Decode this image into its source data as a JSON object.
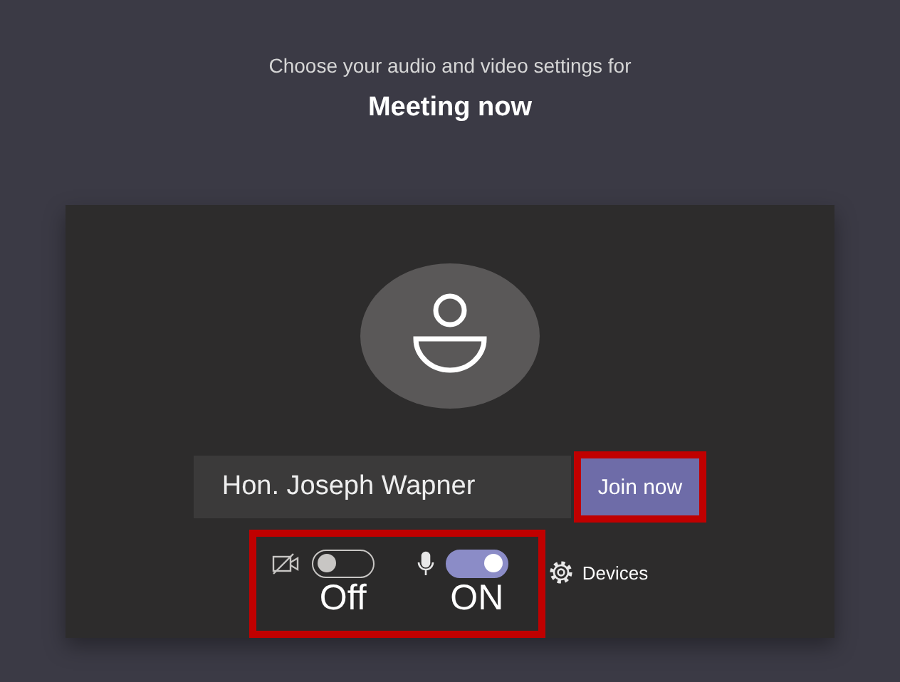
{
  "header": {
    "subtitle": "Choose your audio and video settings for",
    "title": "Meeting now"
  },
  "name_field": {
    "value": "Hon. Joseph Wapner"
  },
  "join_button": {
    "label": "Join now",
    "highlighted": true
  },
  "toggle_group": {
    "highlighted": true
  },
  "toggles": [
    {
      "kind": "camera",
      "on": false,
      "caption": "Off"
    },
    {
      "kind": "microphone",
      "on": true,
      "caption": "ON"
    }
  ],
  "devices_button": {
    "label": "Devices"
  }
}
